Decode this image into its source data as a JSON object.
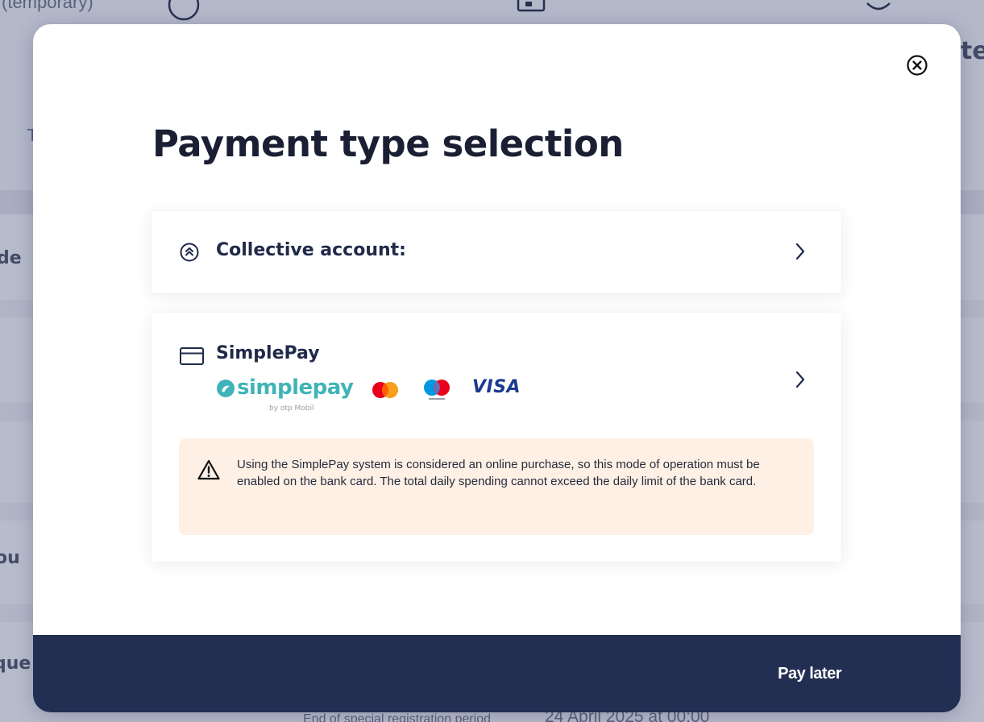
{
  "background": {
    "header_caption": "(temporary)",
    "fragments": [
      "T",
      "de",
      "ou",
      "que"
    ],
    "title_fragment": "te",
    "footer_label": "End of special registration period",
    "footer_value": "24 April 2025 at 00:00"
  },
  "modal": {
    "title": "Payment type selection",
    "close_icon": "close-circle-icon",
    "options": [
      {
        "label": "Collective account:",
        "icon": "double-chevron-up-circle-icon"
      },
      {
        "label": "SimplePay",
        "icon": "credit-card-icon",
        "logos": {
          "simplepay_word": "simplepay",
          "simplepay_sub": "by otp Mobil",
          "visa": "VISA"
        },
        "notice": "Using the SimplePay system is considered an online purchase, so this mode of operation must be enabled on the bank card. The total daily spending cannot exceed the daily limit of the bank card."
      }
    ]
  },
  "footer": {
    "pay_later": "Pay later"
  },
  "colors": {
    "navy": "#222f53",
    "text_dark": "#202a49",
    "notice_bg": "#fef0e5",
    "simplepay_teal": "#3fb4b8",
    "mastercard_red": "#eb001b",
    "mastercard_yellow": "#f79e1b",
    "maestro_blue": "#0099df",
    "visa_blue": "#1a3a8f"
  }
}
